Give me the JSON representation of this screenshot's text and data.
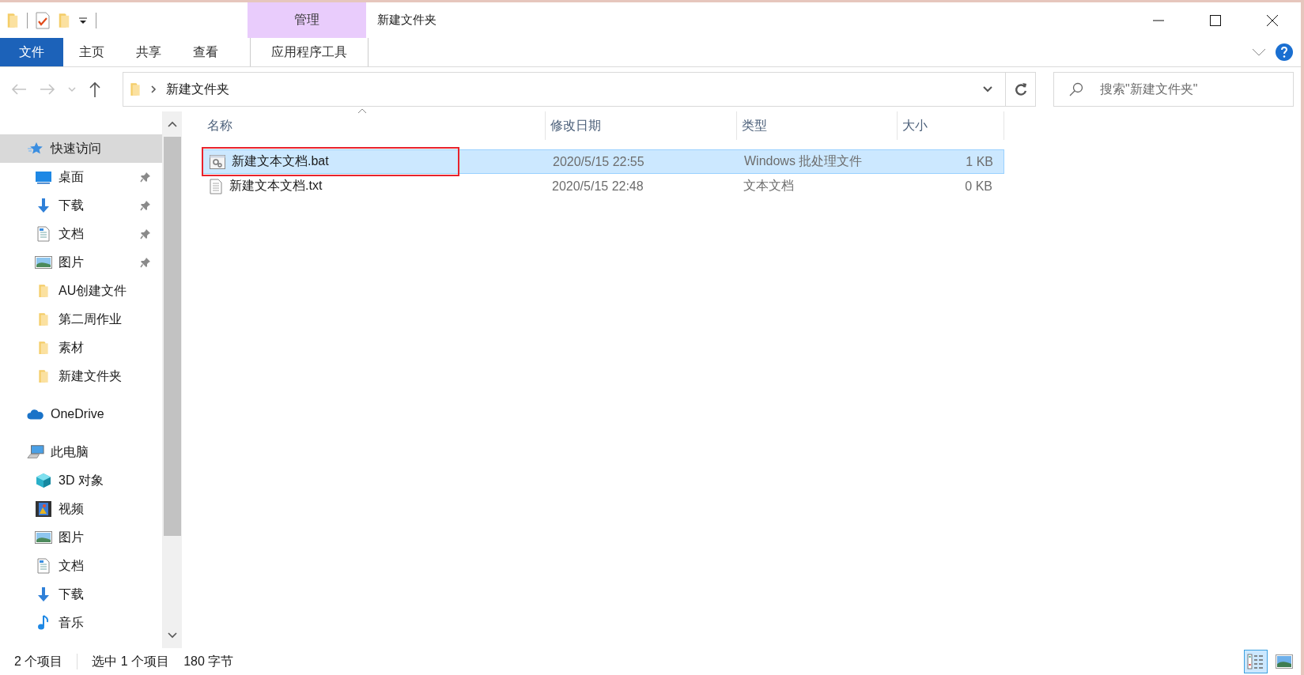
{
  "window": {
    "title": "新建文件夹"
  },
  "ribbon": {
    "context_group": "管理",
    "tabs": [
      {
        "label": "文件",
        "kind": "file"
      },
      {
        "label": "主页",
        "kind": "tab"
      },
      {
        "label": "共享",
        "kind": "tab"
      },
      {
        "label": "查看",
        "kind": "tab"
      },
      {
        "label": "应用程序工具",
        "kind": "context"
      }
    ]
  },
  "address_bar": {
    "path": [
      "新建文件夹"
    ],
    "search": {
      "placeholder": "搜索\"新建文件夹\""
    }
  },
  "sidebar": {
    "items": [
      {
        "label": "快速访问",
        "kind": "star",
        "selected": true,
        "children": [
          {
            "label": "桌面",
            "kind": "desktop",
            "pinned": true,
            "selected": false
          },
          {
            "label": "下载",
            "kind": "download",
            "pinned": true,
            "selected": false
          },
          {
            "label": "文档",
            "kind": "document",
            "pinned": true,
            "selected": false
          },
          {
            "label": "图片",
            "kind": "pictures",
            "pinned": true,
            "selected": false
          },
          {
            "label": "AU创建文件",
            "kind": "folder",
            "pinned": false,
            "selected": false
          },
          {
            "label": "第二周作业",
            "kind": "folder",
            "pinned": false,
            "selected": false
          },
          {
            "label": "素材",
            "kind": "folder",
            "pinned": false,
            "selected": false
          },
          {
            "label": "新建文件夹",
            "kind": "folder",
            "pinned": false,
            "selected": false
          }
        ]
      },
      {
        "label": "OneDrive",
        "kind": "cloud",
        "selected": false
      },
      {
        "label": "此电脑",
        "kind": "pc",
        "selected": false,
        "children": [
          {
            "label": "3D 对象",
            "kind": "cube",
            "pinned": false,
            "selected": false
          },
          {
            "label": "视频",
            "kind": "video",
            "pinned": false,
            "selected": false
          },
          {
            "label": "图片",
            "kind": "pictures",
            "pinned": false,
            "selected": false
          },
          {
            "label": "文档",
            "kind": "document",
            "pinned": false,
            "selected": false
          },
          {
            "label": "下载",
            "kind": "download",
            "pinned": false,
            "selected": false
          },
          {
            "label": "音乐",
            "kind": "music",
            "pinned": false,
            "selected": false
          }
        ]
      }
    ]
  },
  "table": {
    "columns": [
      {
        "label": "名称",
        "sorted": true
      },
      {
        "label": "修改日期",
        "sorted": false
      },
      {
        "label": "类型",
        "sorted": false
      },
      {
        "label": "大小",
        "sorted": false
      }
    ],
    "rows": [
      {
        "name": "新建文本文档.bat",
        "modified": "2020/5/15 22:55",
        "type": "Windows 批处理文件",
        "size": "1 KB",
        "kind": "batch",
        "selected": true,
        "highlighted": true
      },
      {
        "name": "新建文本文档.txt",
        "modified": "2020/5/15 22:48",
        "type": "文本文档",
        "size": "0 KB",
        "kind": "text",
        "selected": false,
        "highlighted": false
      }
    ]
  },
  "status_bar": {
    "item_count": "2 个项目",
    "selection": "选中 1 个项目",
    "selection_size": "180 字节",
    "views": [
      {
        "kind": "details",
        "selected": true
      },
      {
        "kind": "thumbnails",
        "selected": false
      }
    ]
  }
}
